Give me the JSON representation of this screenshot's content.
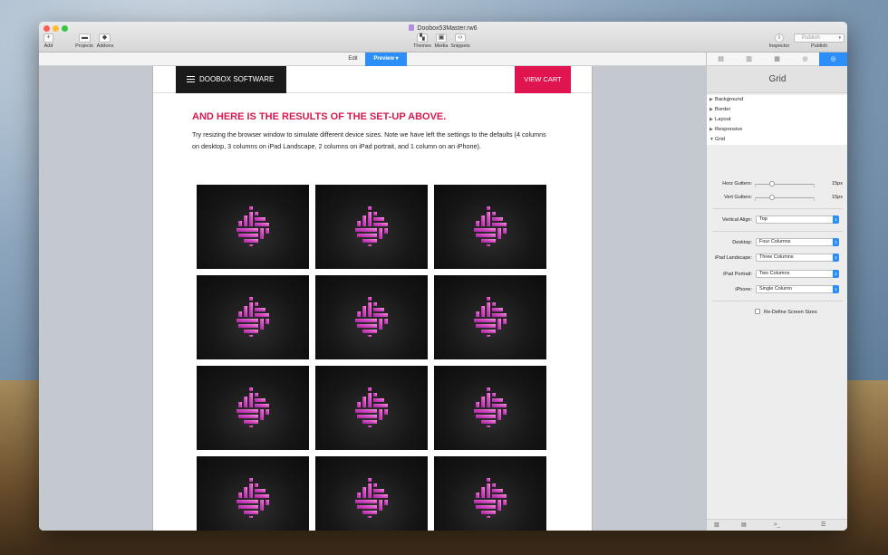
{
  "window": {
    "document_title": "Doobox53Master.rw6"
  },
  "toolbar": {
    "add_label": "Add",
    "projects_label": "Projects",
    "addons_label": "Addons",
    "themes_label": "Themes",
    "media_label": "Media",
    "snippets_label": "Snippets",
    "inspector_label": "Inspector",
    "publish_label": "Publish",
    "publish_button_text": "Publish"
  },
  "view_tabs": {
    "edit": "Edit",
    "preview": "Preview"
  },
  "site": {
    "brand": "DOOBOX SOFTWARE",
    "cart": "VIEW CART",
    "heading": "AND HERE IS THE RESULTS OF THE SET-UP ABOVE.",
    "body": "Try resizing the browser window to simulate different device sizes. Note we have left the settings to the defaults (4 columns on desktop, 3 columns on iPad Landscape, 2 columns on iPad portrait, and 1 column on an iPhone).",
    "grid_rows": 4,
    "grid_columns": 3,
    "accent_color": "#e0144e"
  },
  "inspector": {
    "title": "Grid",
    "sections": [
      "Background",
      "Border",
      "Layout",
      "Responsive",
      "Grid"
    ],
    "expanded_section": "Grid",
    "horz_gutters": {
      "label": "Horz Gutters:",
      "value": "15px"
    },
    "vert_gutters": {
      "label": "Vert Gutters:",
      "value": "15px"
    },
    "vertical_align": {
      "label": "Vertical Align:",
      "value": "Top"
    },
    "desktop": {
      "label": "Desktop:",
      "value": "Four Columns"
    },
    "ipad_landscape": {
      "label": "iPad Landscape:",
      "value": "Three Columns"
    },
    "ipad_portrait": {
      "label": "iPad Portrait:",
      "value": "Two Columns"
    },
    "iphone": {
      "label": "iPhone:",
      "value": "Single Column"
    },
    "redefine": "Re-Define Screen Sizes",
    "active_tab_color": "#2c8ef8"
  }
}
